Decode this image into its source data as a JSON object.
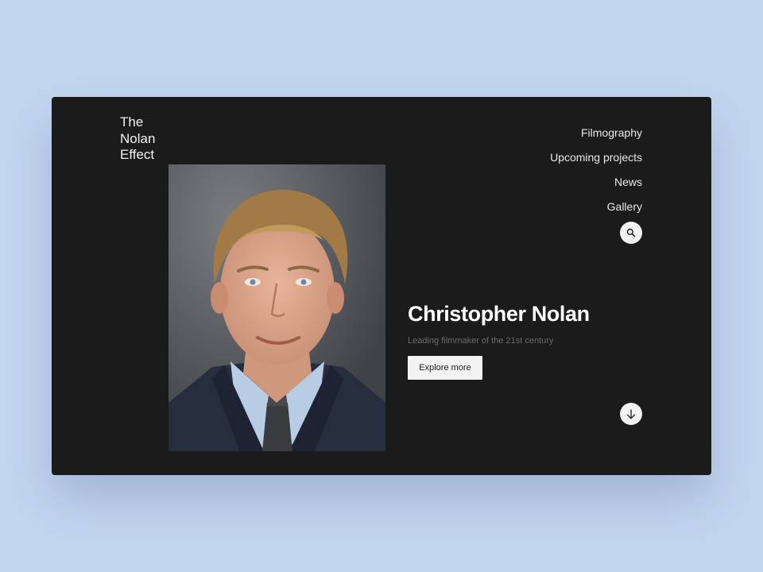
{
  "logo": {
    "line1": "The",
    "line2": "Nolan",
    "line3": "Effect"
  },
  "nav": {
    "items": [
      {
        "label": "Filmography"
      },
      {
        "label": "Upcoming projects"
      },
      {
        "label": "News"
      },
      {
        "label": "Gallery"
      }
    ]
  },
  "hero": {
    "name": "Christopher Nolan",
    "tagline": "Leading filmmaker of the 21st century",
    "cta_label": "Explore more"
  },
  "icons": {
    "search": "search-icon",
    "scroll": "arrow-down-icon"
  },
  "colors": {
    "page_background": "#c3d6f0",
    "card_background": "#1b1b1b",
    "button_background": "#f3f3f3",
    "subtitle_text": "#6a6a6a"
  }
}
